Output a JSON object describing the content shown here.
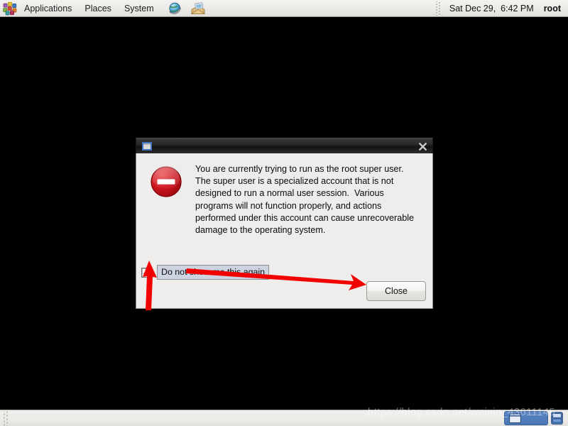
{
  "top_panel": {
    "app_menu_icon": "red-hat-puzzle-icon",
    "menus": [
      {
        "label": "Applications",
        "name": "menu-applications"
      },
      {
        "label": "Places",
        "name": "menu-places"
      },
      {
        "label": "System",
        "name": "menu-system"
      }
    ],
    "launchers": [
      {
        "name": "web-browser-launcher-icon",
        "title": "Firefox Web Browser"
      },
      {
        "name": "email-client-launcher-icon",
        "title": "Evolution Mail"
      }
    ],
    "clock": "Sat Dec 29,  6:42 PM",
    "user": "root"
  },
  "dialog": {
    "title": "",
    "window_icon": "window-icon",
    "close_icon": "close-icon",
    "alert_icon": "error-stop-icon",
    "message": "You are currently trying to run as the root super user.  The super user is a specialized account that is not designed to run a normal user session.  Various programs will not function properly, and actions performed under this account can cause unrecoverable damage to the operating system.",
    "checkbox": {
      "label": "Do not show me this again",
      "checked": true,
      "focused": true
    },
    "close_button": "Close"
  },
  "annotations": {
    "arrow_color": "#f00000",
    "arrow_to_checkbox": "red-arrow-pointing-to-checkbox",
    "arrow_to_close_button": "red-arrow-pointing-to-close-button"
  },
  "bottom_panel": {
    "grip": "panel-grip-handle",
    "task_items": [
      {
        "name": "taskbar-window-item",
        "icon": "window-icon",
        "label": ""
      }
    ],
    "tray_icon": "workspace-switcher-icon"
  },
  "watermark": {
    "text": "https://blog.csdn.net/weixin_43611145"
  },
  "colors": {
    "panel_bg": "#ecebe8",
    "desktop_bg": "#000000",
    "dialog_bg": "#eeedeb",
    "titlebar_bg": "#1e1e1e",
    "alert_red": "#cc1111",
    "focus_blue": "#cdd3e0",
    "task_blue": "#4a76b4"
  }
}
